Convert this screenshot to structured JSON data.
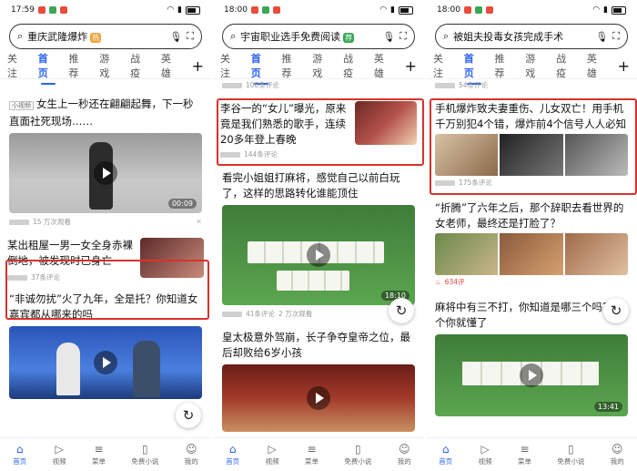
{
  "phones": [
    {
      "time": "17:59",
      "search_text": "重庆武隆爆炸",
      "search_tag": "热",
      "tabs": [
        "关注",
        "首页",
        "推荐",
        "游戏",
        "战疫",
        "英雄"
      ],
      "cards": [
        {
          "badge": "小视频",
          "title": "女生上一秒还在翩翩起舞，下一秒直面社死现场……",
          "duration": "00:09",
          "views": "15 万次观看"
        },
        {
          "title": "  某出租屋一男一女全身赤裸倒地，被发现时已身亡",
          "comments": "37条评论"
        },
        {
          "title": "“非诚勿扰”火了九年，全是托？你知道女嘉宾都从哪来的吗"
        }
      ]
    },
    {
      "time": "18:00",
      "search_text": "宇宙职业选手免费阅读",
      "search_tag": "荐",
      "tabs": [
        "关注",
        "首页",
        "推荐",
        "游戏",
        "战疫",
        "英雄"
      ],
      "cards": [
        {
          "title": "",
          "comments": "108条评论"
        },
        {
          "title": "李谷一的“女儿”曝光，原来竟是我们熟悉的歌手，连续20多年登上春晚",
          "comments": "144条评论"
        },
        {
          "title": "看完小姐姐打麻将，感觉自己以前白玩了，这样的思路转化谁能顶住",
          "duration": "18:10",
          "comments": "41条评论",
          "views": "2 万次观看"
        },
        {
          "title": "皇太极意外驾崩，长子争夺皇帝之位，最后却败给6岁小孩"
        }
      ]
    },
    {
      "time": "18:00",
      "search_text": "被姐夫投毒女孩完成手术",
      "search_tag": "",
      "tabs": [
        "关注",
        "首页",
        "推荐",
        "游戏",
        "战疫",
        "英雄"
      ],
      "cards": [
        {
          "title": "",
          "comments": "54条评论"
        },
        {
          "title": "手机爆炸致夫妻重伤、儿女双亡！用手机千万别犯4个错，爆炸前4个信号人人必知",
          "comments": "175条评论"
        },
        {
          "title": "“折腾”了六年之后，那个辞职去看世界的女老师，最终还是打脸了？",
          "comments": "634评"
        },
        {
          "title": "麻将中有三不打，你知道是哪三个吗？这个你就懂了",
          "duration": "13:41"
        }
      ]
    }
  ],
  "bottom_nav": [
    "首页",
    "视频",
    "菜单",
    "免费小说",
    "我的"
  ],
  "colors": {
    "accent": "#2a62f5",
    "highlight": "#d8322c"
  }
}
